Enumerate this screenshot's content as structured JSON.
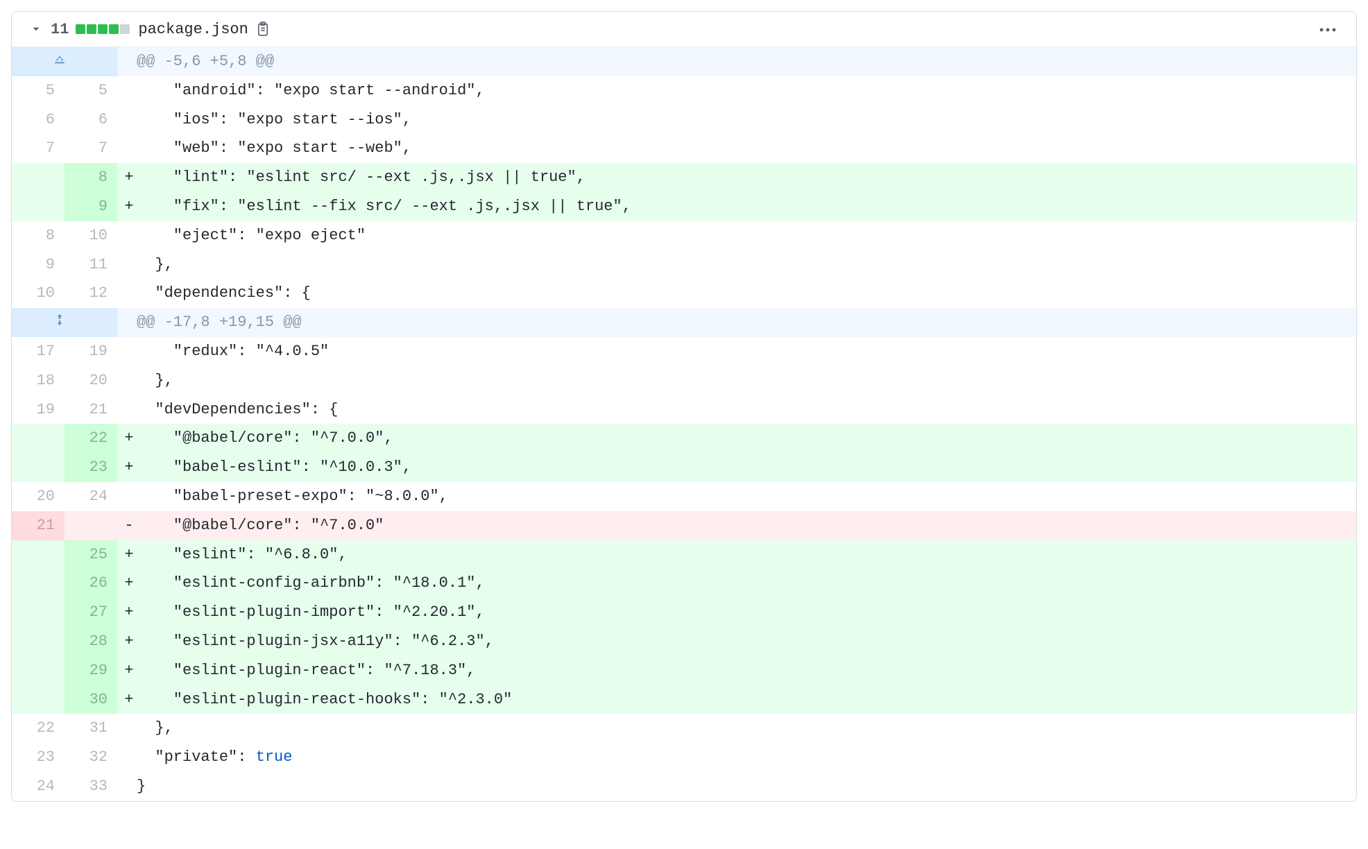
{
  "header": {
    "change_count": "11",
    "file_name": "package.json"
  },
  "diffstat_blocks": [
    "add",
    "add",
    "add",
    "add",
    "neutral"
  ],
  "rows": [
    {
      "type": "hunk",
      "icon": "expand-up",
      "text": "@@ -5,6 +5,8 @@"
    },
    {
      "type": "ctx",
      "old": "5",
      "new": "5",
      "code": "    \"android\": \"expo start --android\","
    },
    {
      "type": "ctx",
      "old": "6",
      "new": "6",
      "code": "    \"ios\": \"expo start --ios\","
    },
    {
      "type": "ctx",
      "old": "7",
      "new": "7",
      "code": "    \"web\": \"expo start --web\","
    },
    {
      "type": "add",
      "old": "",
      "new": "8",
      "code": "    \"lint\": \"eslint src/ --ext .js,.jsx || true\","
    },
    {
      "type": "add",
      "old": "",
      "new": "9",
      "code": "    \"fix\": \"eslint --fix src/ --ext .js,.jsx || true\","
    },
    {
      "type": "ctx",
      "old": "8",
      "new": "10",
      "code": "    \"eject\": \"expo eject\""
    },
    {
      "type": "ctx",
      "old": "9",
      "new": "11",
      "code": "  },"
    },
    {
      "type": "ctx",
      "old": "10",
      "new": "12",
      "code": "  \"dependencies\": {"
    },
    {
      "type": "hunk",
      "icon": "expand-both",
      "text": "@@ -17,8 +19,15 @@"
    },
    {
      "type": "ctx",
      "old": "17",
      "new": "19",
      "code": "    \"redux\": \"^4.0.5\""
    },
    {
      "type": "ctx",
      "old": "18",
      "new": "20",
      "code": "  },"
    },
    {
      "type": "ctx",
      "old": "19",
      "new": "21",
      "code": "  \"devDependencies\": {"
    },
    {
      "type": "add",
      "old": "",
      "new": "22",
      "code": "    \"@babel/core\": \"^7.0.0\","
    },
    {
      "type": "add",
      "old": "",
      "new": "23",
      "code": "    \"babel-eslint\": \"^10.0.3\","
    },
    {
      "type": "ctx",
      "old": "20",
      "new": "24",
      "code": "    \"babel-preset-expo\": \"~8.0.0\","
    },
    {
      "type": "del",
      "old": "21",
      "new": "",
      "code": "    \"@babel/core\": \"^7.0.0\""
    },
    {
      "type": "add",
      "old": "",
      "new": "25",
      "code": "    \"eslint\": \"^6.8.0\","
    },
    {
      "type": "add",
      "old": "",
      "new": "26",
      "code": "    \"eslint-config-airbnb\": \"^18.0.1\","
    },
    {
      "type": "add",
      "old": "",
      "new": "27",
      "code": "    \"eslint-plugin-import\": \"^2.20.1\","
    },
    {
      "type": "add",
      "old": "",
      "new": "28",
      "code": "    \"eslint-plugin-jsx-a11y\": \"^6.2.3\","
    },
    {
      "type": "add",
      "old": "",
      "new": "29",
      "code": "    \"eslint-plugin-react\": \"^7.18.3\","
    },
    {
      "type": "add",
      "old": "",
      "new": "30",
      "code": "    \"eslint-plugin-react-hooks\": \"^2.3.0\""
    },
    {
      "type": "ctx",
      "old": "22",
      "new": "31",
      "code": "  },"
    },
    {
      "type": "ctx",
      "old": "23",
      "new": "32",
      "code": "  \"private\": ",
      "code_suffix_bool": "true"
    },
    {
      "type": "ctx",
      "old": "24",
      "new": "33",
      "code": "}"
    }
  ]
}
